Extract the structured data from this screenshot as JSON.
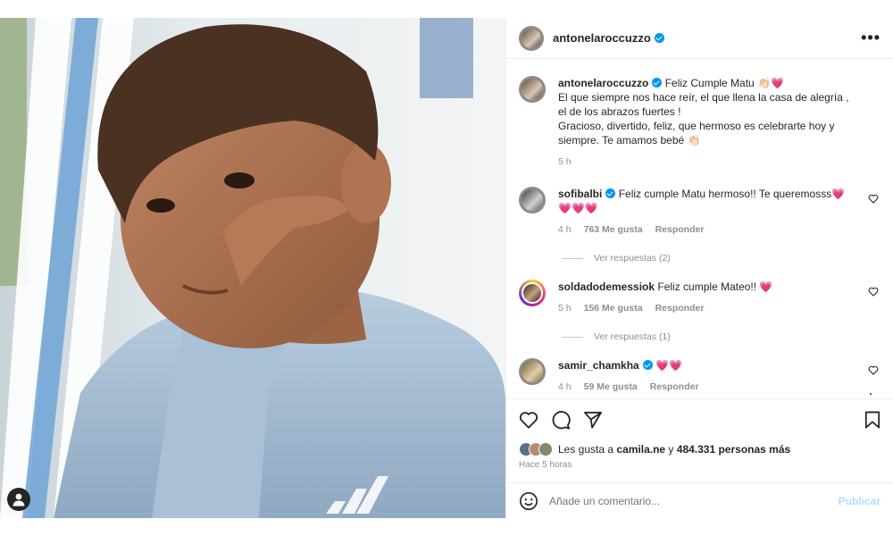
{
  "header": {
    "username": "antonelaroccuzzo",
    "more": "•••"
  },
  "caption": {
    "username": "antonelaroccuzzo",
    "text_line1": "Feliz Cumple Matu 👏🏻💗",
    "text_line2": "El que siempre nos hace reír, el que llena la casa de alegría , el de los abrazos fuertes !",
    "text_line3": "Gracioso, divertido, feliz, que hermoso es celebrarte hoy y siempre. Te amamos bebé 👏🏻",
    "time": "5 h"
  },
  "comments": [
    {
      "username": "sofibalbi",
      "text": "Feliz cumple Matu hermoso!! Te queremosss💗💗💗💗",
      "time": "4 h",
      "likes": "763 Me gusta",
      "reply": "Responder",
      "view_replies": "Ver respuestas (2)"
    },
    {
      "username": "soldadodemessiok",
      "text": "Feliz cumple Mateo!! 💗",
      "time": "5 h",
      "likes": "156 Me gusta",
      "reply": "Responder",
      "view_replies": "Ver respuestas (1)"
    },
    {
      "username": "samir_chamkha",
      "text": "💗💗",
      "time": "4 h",
      "likes": "59 Me gusta",
      "reply": "Responder"
    }
  ],
  "likes_line": {
    "prefix": "Les gusta a ",
    "user": "camila.ne",
    "middle": " y ",
    "count": "484.331 personas más"
  },
  "posted_ago": "Hace 5 horas",
  "add_comment": {
    "placeholder": "Añade un comentario...",
    "publish": "Publicar"
  },
  "colors": {
    "verified": "#0095f6",
    "publish_disabled": "#b2dffc",
    "heart": "#ff3040"
  }
}
